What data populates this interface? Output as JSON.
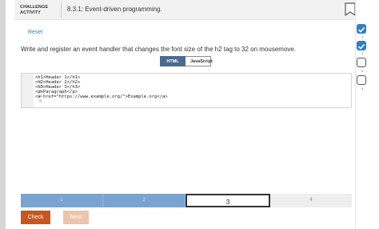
{
  "header": {
    "activity_label": "CHALLENGE ACTIVITY",
    "title": "8.3.1: Event-driven programming."
  },
  "reset_label": "Reset",
  "instructions": "Write and register an event handler that changes the font size of the h2 tag to 32 on mousemove.",
  "tabs": [
    {
      "label": "HTML",
      "active": true
    },
    {
      "label": "JavaScript",
      "active": false
    }
  ],
  "editor": {
    "lines": [
      {
        "num": "1",
        "code": "<h1>Header 1</h1>"
      },
      {
        "num": "2",
        "code": "<h2>Header 2</h2>"
      },
      {
        "num": "3",
        "code": "<h3>Header 3</h3>"
      },
      {
        "num": "4",
        "code": "<p>Paragraph</p>"
      },
      {
        "num": "5",
        "code": "<a href=\"https://www.example.org/\">Example.org</a>"
      }
    ]
  },
  "progress": [
    {
      "label": "1",
      "state": "done"
    },
    {
      "label": "2",
      "state": "done"
    },
    {
      "label": "3",
      "state": "current"
    },
    {
      "label": "4",
      "state": "future"
    }
  ],
  "buttons": {
    "check": "Check",
    "next": "Next"
  },
  "steps": [
    {
      "num": "1",
      "state": "done"
    },
    {
      "num": "2",
      "state": "done"
    },
    {
      "num": "3",
      "state": "todo"
    },
    {
      "num": "4",
      "state": "todo"
    }
  ],
  "colors": {
    "accent": "#2f7fc1",
    "check_button": "#c9551f",
    "progress_done": "#7aa3cf"
  }
}
